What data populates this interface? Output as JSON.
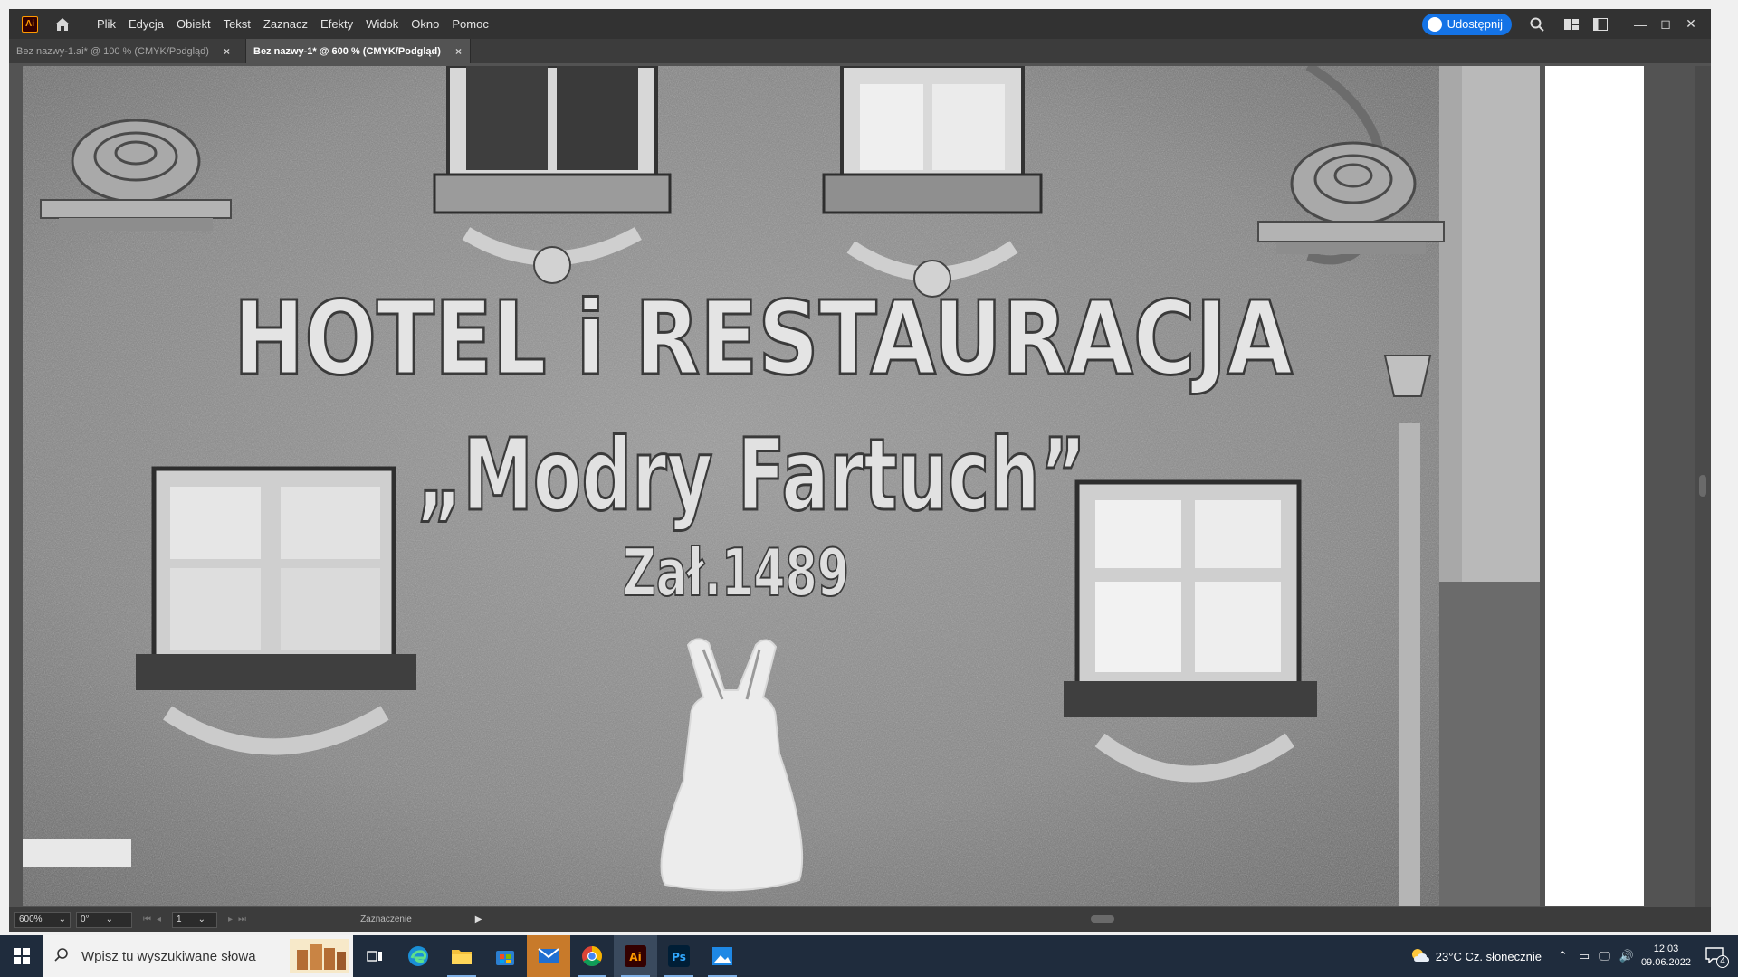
{
  "app": {
    "logo_text": "Ai",
    "menu": [
      "Plik",
      "Edycja",
      "Obiekt",
      "Tekst",
      "Zaznacz",
      "Efekty",
      "Widok",
      "Okno",
      "Pomoc"
    ],
    "share_label": "Udostępnij",
    "tabs": [
      {
        "label": "Bez nazwy-1.ai* @ 100 % (CMYK/Podgląd)",
        "active": false
      },
      {
        "label": "Bez nazwy-1* @ 600 % (CMYK/Podgląd)",
        "active": true
      }
    ],
    "tab_close": "×"
  },
  "artwork": {
    "line1": "HOTEL i RESTAURACJA",
    "line2": "„Modry Fartuch”",
    "line3": "Zał.1489"
  },
  "status": {
    "zoom": "600%",
    "rotation": "0°",
    "artboard": "1",
    "tool": "Zaznaczenie"
  },
  "taskbar": {
    "search_placeholder": "Wpisz tu wyszukiwane słowa",
    "weather": "23°C  Cz. słonecznie",
    "time": "12:03",
    "date": "09.06.2022",
    "notif_count": "4",
    "apps": [
      "task-view",
      "edge",
      "file-explorer",
      "store",
      "mail",
      "chrome",
      "illustrator",
      "photoshop",
      "photos"
    ]
  }
}
